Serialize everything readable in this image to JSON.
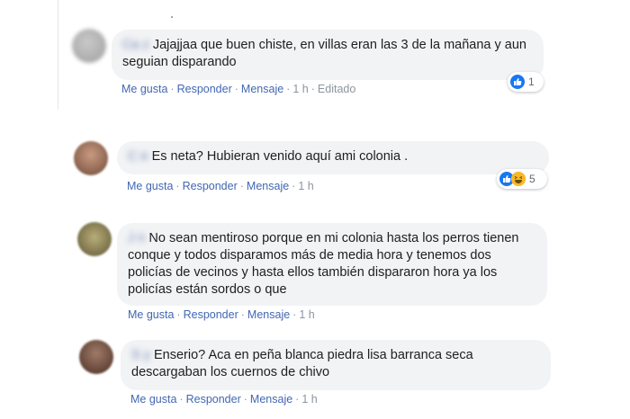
{
  "comments": [
    {
      "author": "Ca                 z",
      "text": "Jajajjaa que buen chiste, en villas eran las 3 de la mañana y aun seguian disparando",
      "actions": {
        "like": "Me gusta",
        "reply": "Responder",
        "message": "Mensaje",
        "time": "1 h",
        "edited": "Editado"
      },
      "reaction_count": "1",
      "reaction_icons": [
        "like-icon"
      ]
    },
    {
      "author": "C               e",
      "text": "Es neta? Hubieran venido aquí ami colonia .",
      "actions": {
        "like": "Me gusta",
        "reply": "Responder",
        "message": "Mensaje",
        "time": "1 h"
      },
      "reaction_count": "5",
      "reaction_icons": [
        "like-icon",
        "haha-icon"
      ]
    },
    {
      "author": "J                   n",
      "text": "No sean mentiroso porque en mi colonia hasta los perros tienen conque y todos disparamos más de media hora y tenemos dos policías de vecinos y hasta ellos también dispararon hora ya los policías están sordos o que",
      "actions": {
        "like": "Me gusta",
        "reply": "Responder",
        "message": "Mensaje",
        "time": "1 h"
      }
    },
    {
      "author": "S                    y",
      "text": "Enserio? Aca en peña blanca piedra lisa barranca seca descargaban los cuernos de chivo",
      "actions": {
        "like": "Me gusta",
        "reply": "Responder",
        "message": "Mensaje",
        "time": "1 h"
      }
    }
  ],
  "colors": {
    "link": "#4267b2",
    "author": "#385898",
    "bubble": "#f2f3f5",
    "meta": "#8d949e",
    "like": "#1877f2",
    "haha": "#f7b928"
  }
}
